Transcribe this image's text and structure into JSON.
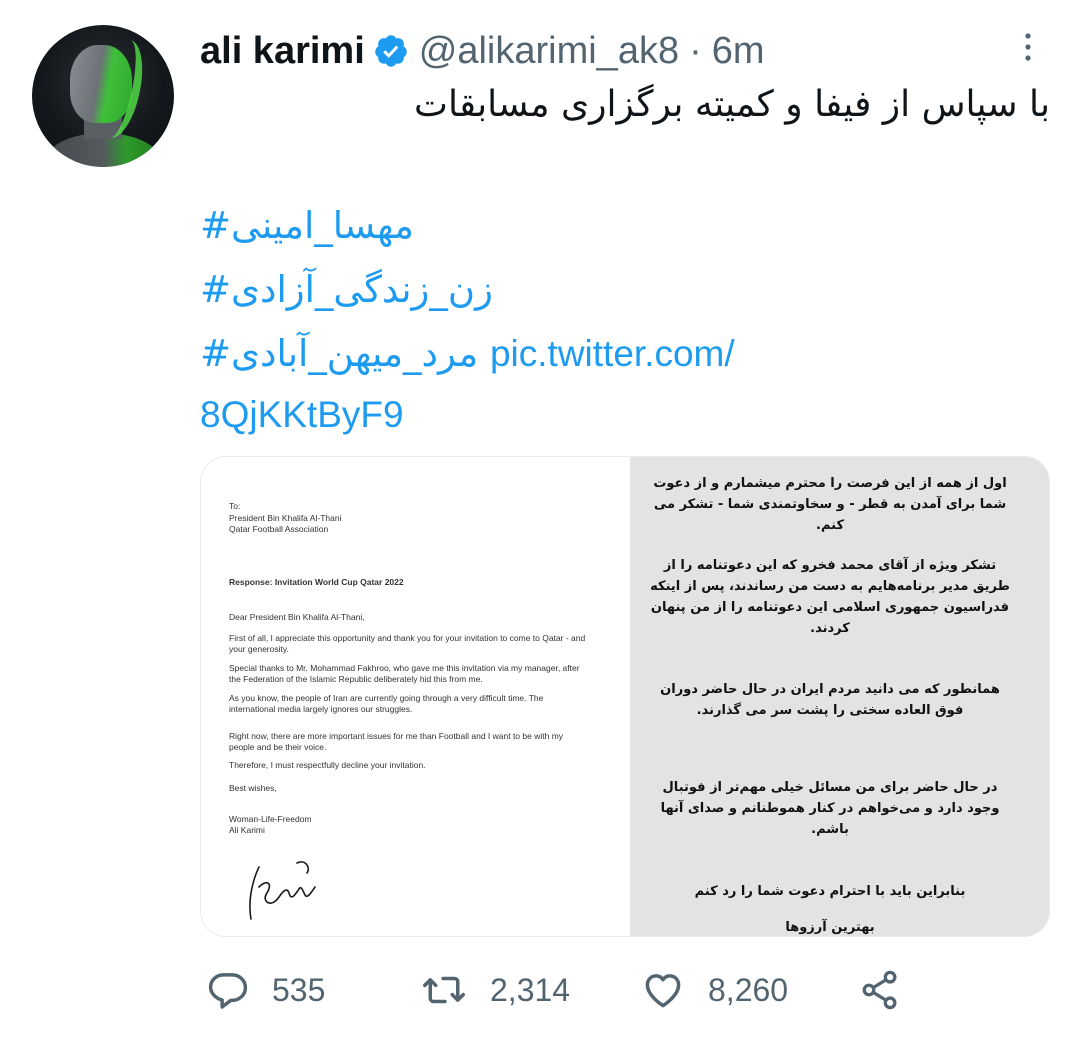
{
  "tweet": {
    "display_name": "ali karimi",
    "handle": "@alikarimi_ak8",
    "separator": "·",
    "time": "6m",
    "text_line": "با سپاس از فیفا و کمیته برگزاری مسابقات",
    "hashtags": [
      "#مهسا_امینی",
      "#زن_زندگی_آزادی",
      "#مرد_میهن_آبادی"
    ],
    "link_part1": "pic.twitter.com/",
    "link_part2": "8QjKKtByF9"
  },
  "letter": {
    "to": "To:",
    "recipient": "President Bin Khalifa Al-Thani",
    "org": "Qatar Football Association",
    "subject": "Response: Invitation World Cup Qatar 2022",
    "greeting": "Dear President Bin Khalifa Al-Thani,",
    "p1": "First of all, I appreciate this opportunity and thank you for your invitation to come to Qatar - and your generosity.",
    "p2": "Special thanks to Mr. Mohammad Fakhroo, who gave me this invitation via my manager, after the Federation of the Islamic Republic deliberately hid this from me.",
    "p3": "As you know, the people of Iran are currently going through a very difficult time. The international media largely ignores our struggles.",
    "p4": "Right now, there are more important issues for me than Football and I want to be with my people and be their voice.",
    "p5": "Therefore, I must respectfully decline your invitation.",
    "closing": "Best wishes,",
    "sign1": "Woman-Life-Freedom",
    "sign2": "Ali Karimi"
  },
  "persian_letter": {
    "p1": "اول از همه از این فرصت را محترم میشمارم و از دعوت شما برای آمدن به قطر - و سخاوتمندی شما - تشکر می کنم.",
    "p2": "تشکر ویژه از آقای محمد فخرو که این دعوتنامه را از طریق مدیر برنامه‌هایم به دست من رساندند، پس از اینکه فدراسیون جمهوری اسلامی این دعوتنامه را از من پنهان کردند.",
    "p3": "همانطور که می دانید مردم ایران در حال حاضر دوران فوق العاده سختی را پشت سر می گذارند.",
    "p4": "در حال حاضر برای من مسائل خیلی مهم‌تر از فوتبال وجود دارد و می‌خواهم در کنار هموطنانم و صدای آنها باشم.",
    "p5": "بنابراین باید با احترام دعوت شما را رد کنم",
    "p6": "بهترین آرزوها"
  },
  "actions": {
    "reply_count": "535",
    "retweet_count": "2,314",
    "like_count": "8,260"
  },
  "colors": {
    "link": "#1d9bf0",
    "secondary_text": "#536471",
    "primary_text": "#0f1419",
    "verified": "#1d9bf0"
  },
  "icons": [
    "verified-badge-icon",
    "more-options-icon",
    "reply-icon",
    "retweet-icon",
    "like-icon",
    "share-icon"
  ]
}
